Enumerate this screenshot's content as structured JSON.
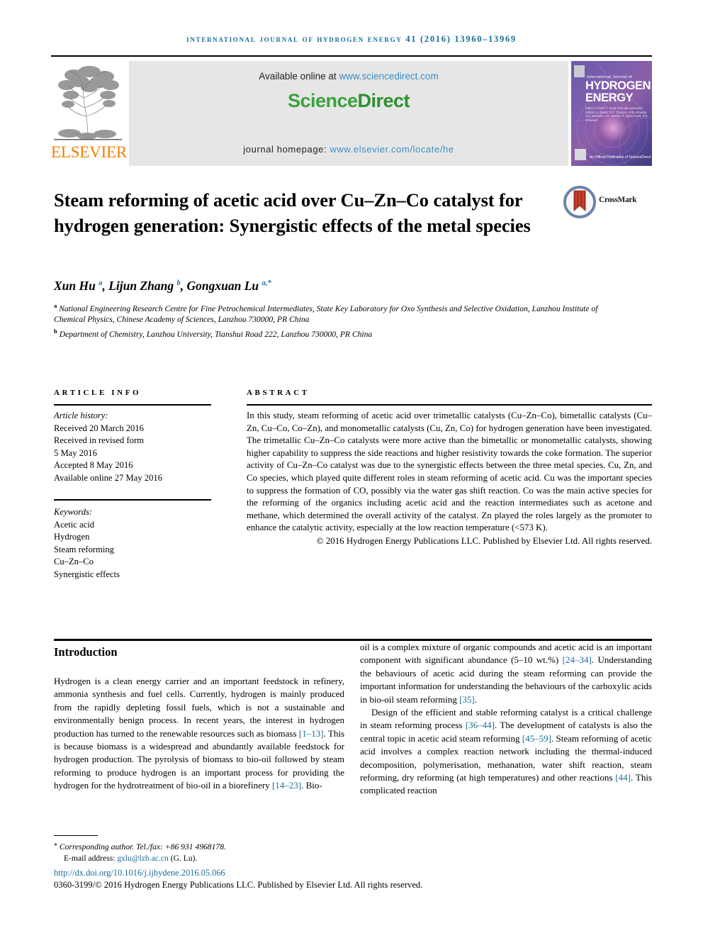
{
  "running_head": "International Journal of Hydrogen Energy 41 (2016) 13960–13969",
  "masthead": {
    "elsevier_wordmark": "ELSEVIER",
    "available_prefix": "Available online at ",
    "available_url": "www.sciencedirect.com",
    "sciencedirect_part1": "Science",
    "sciencedirect_part2": "Direct",
    "homepage_prefix": "journal homepage: ",
    "homepage_url": "www.elsevier.com/locate/he",
    "cover": {
      "line_top": "International Journal of",
      "title_line1": "HYDROGEN",
      "title_line2": "ENERGY",
      "meta": "Editor-in-Chief: T. Nejat Veziroglu\nAssociate Editors: A. Bolick, D.C. Cracken, M.B. Almeida, N.Z. Muradov, J.R. Bartlett, E. Taylor Lund, D.Y. Goswami",
      "publisher": "An Official Publication of\nScienceDirect"
    }
  },
  "article": {
    "title": "Steam reforming of acetic acid over Cu–Zn–Co catalyst for hydrogen generation: Synergistic effects of the metal species",
    "crossmark_label": "CrossMark",
    "authors_html": "Xun Hu <sup>a</sup>, Lijun Zhang <sup>b</sup>, Gongxuan Lu <sup>a,*</sup>",
    "affiliation_a_marker": "a",
    "affiliation_a": "National Engineering Research Centre for Fine Petrochemical Intermediates, State Key Laboratory for Oxo Synthesis and Selective Oxidation, Lanzhou Institute of Chemical Physics, Chinese Academy of Sciences, Lanzhou 730000, PR China",
    "affiliation_b_marker": "b",
    "affiliation_b": "Department of Chemistry, Lanzhou University, Tianshui Road 222, Lanzhou 730000, PR China"
  },
  "article_info": {
    "heading": "ARTICLE INFO",
    "history_label": "Article history:",
    "history": [
      "Received 20 March 2016",
      "Received in revised form",
      "5 May 2016",
      "Accepted 8 May 2016",
      "Available online 27 May 2016"
    ],
    "keywords_label": "Keywords:",
    "keywords": [
      "Acetic acid",
      "Hydrogen",
      "Steam reforming",
      "Cu–Zn–Co",
      "Synergistic effects"
    ]
  },
  "abstract": {
    "heading": "ABSTRACT",
    "text": "In this study, steam reforming of acetic acid over trimetallic catalysts (Cu–Zn–Co), bimetallic catalysts (Cu–Zn, Cu–Co, Co–Zn), and monometallic catalysts (Cu, Zn, Co) for hydrogen generation have been investigated. The trimetallic Cu–Zn–Co catalysts were more active than the bimetallic or monometallic catalysts, showing higher capability to suppress the side reactions and higher resistivity towards the coke formation. The superior activity of Cu–Zn–Co catalyst was due to the synergistic effects between the three metal species. Cu, Zn, and Co species, which played quite different roles in steam reforming of acetic acid. Cu was the important species to suppress the formation of CO, possibly via the water gas shift reaction. Co was the main active species for the reforming of the organics including acetic acid and the reaction intermediates such as acetone and methane, which determined the overall activity of the catalyst. Zn played the roles largely as the promoter to enhance the catalytic activity, especially at the low reaction temperature (<573 K).",
    "copyright": "© 2016 Hydrogen Energy Publications LLC. Published by Elsevier Ltd. All rights reserved."
  },
  "introduction": {
    "heading": "Introduction",
    "left_p1_a": "Hydrogen is a clean energy carrier and an important feedstock in refinery, ammonia synthesis and fuel cells. Currently, hydrogen is mainly produced from the rapidly depleting fossil fuels, which is not a sustainable and environmentally benign process. In recent years, the interest in hydrogen production has turned to the renewable resources such as biomass ",
    "left_ref1": "[1–13]",
    "left_p1_b": ". This is because biomass is a widespread and abundantly available feedstock for hydrogen production. The pyrolysis of biomass to bio-oil followed by steam reforming to produce hydrogen is an important process for providing the hydrogen for the hydrotreatment of bio-oil in a biorefinery ",
    "left_ref2": "[14–23]",
    "left_p1_c": ". Bio-",
    "right_p1_a": "oil is a complex mixture of organic compounds and acetic acid is an important component with significant abundance (5–10 wt.%) ",
    "right_ref1": "[24–34]",
    "right_p1_b": ". Understanding the behaviours of acetic acid during the steam reforming can provide the important information for understanding the behaviours of the carboxylic acids in bio-oil steam reforming ",
    "right_ref2": "[35]",
    "right_p1_c": ".",
    "right_p2_a": "Design of the efficient and stable reforming catalyst is a critical challenge in steam reforming process ",
    "right_ref3": "[36–44]",
    "right_p2_b": ". The development of catalysts is also the central topic in acetic acid steam reforming ",
    "right_ref4": "[45–59]",
    "right_p2_c": ". Steam reforming of acetic acid involves a complex reaction network including the thermal-induced decomposition, polymerisation, methanation, water shift reaction, steam reforming, dry reforming (at high temperatures) and other reactions ",
    "right_ref5": "[44]",
    "right_p2_d": ". This complicated reaction"
  },
  "footer": {
    "corresponding_star": "*",
    "corresponding": " Corresponding author. Tel./fax: +86 931 4968178.",
    "email_label": "E-mail address: ",
    "email": "gxlu@lzb.ac.cn",
    "email_suffix": " (G. Lu).",
    "doi": "http://dx.doi.org/10.1016/j.ijhydene.2016.05.066",
    "copyright": "0360-3199/© 2016 Hydrogen Energy Publications LLC. Published by Elsevier Ltd. All rights reserved."
  },
  "colors": {
    "link": "#1a6c99",
    "sciencedirect_green": "#3ba23b",
    "elsevier_orange": "#F08000"
  }
}
